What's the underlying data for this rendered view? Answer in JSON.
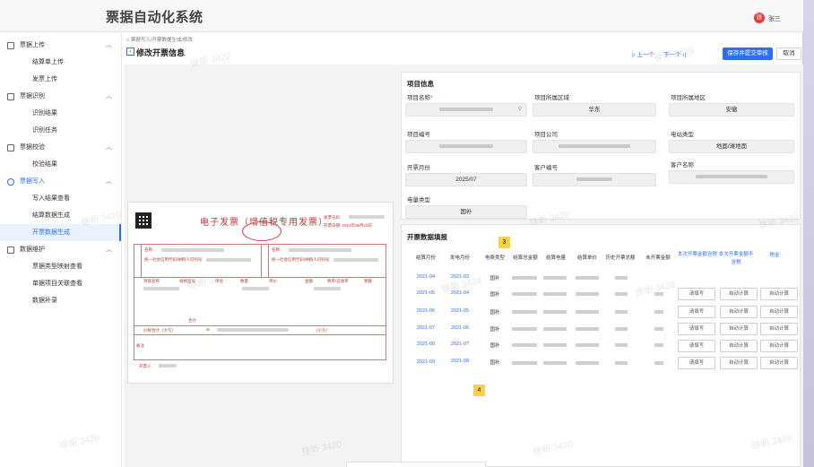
{
  "app": {
    "title": "票据自动化系统",
    "user": "张三",
    "avatar_initial": "张"
  },
  "sidebar": {
    "groups": [
      {
        "label": "票据上传",
        "items": [
          "结算单上传",
          "发票上传"
        ]
      },
      {
        "label": "票据识别",
        "items": [
          "识别结果",
          "识别任务"
        ]
      },
      {
        "label": "票据校验",
        "items": [
          "校验结果"
        ]
      },
      {
        "label": "票据写入",
        "items": [
          "写入结果查看",
          "结算数据生成",
          "开票数据生成"
        ],
        "active_item": "开票数据生成"
      },
      {
        "label": "数据维护",
        "items": [
          "票据类型映射查看",
          "单据项目关联查看",
          "数据补录"
        ]
      }
    ]
  },
  "breadcrumb": "票据写入/开票数据生成/修改",
  "header": {
    "page_title": "修改开票信息",
    "prev_label": "上一个",
    "next_label": "下一个",
    "save_label": "保存并提交审核",
    "cancel_label": "取消"
  },
  "invoice_image": {
    "title": "电子发票（增值税专用发票）",
    "stamp_text": "全国统一发票监制",
    "invoice_no_label": "发票号码:",
    "date_label": "开票日期: 2021年08月23日",
    "buyer_label": "购买方信息",
    "seller_label": "销售方信息",
    "name_label": "名称:",
    "taxid_label": "统一社会信用代码/纳税人识别号:",
    "item_label": "项目名称",
    "spec_label": "规格型号",
    "unit_label": "单位",
    "qty_label": "数量",
    "price_label": "单价",
    "amount_label": "金额",
    "rate_label": "税率/征收率",
    "tax_label": "税额",
    "total_label": "合计",
    "grand_label": "价税合计（大写）",
    "small_label": "（小写）",
    "remark_label": "备注",
    "issuer_label": "开票人:"
  },
  "project_info": {
    "section_title": "项目信息",
    "name_label": "项目名称",
    "region_label": "项目所属区域",
    "region_value": "华东",
    "area_label": "项目所属地区",
    "area_value": "安徽",
    "code_label": "项目编号",
    "company_label": "项目公司",
    "station_label": "电站类型",
    "station_value": "地面/滩地面",
    "month_label": "开票月份",
    "month_value": "2025/07",
    "customer_code_label": "客户编号",
    "customer_name_label": "客户名称",
    "power_type_label": "电量类型",
    "power_type_value": "国补"
  },
  "table": {
    "section_title": "开票数据填报",
    "headers": [
      "结算月份",
      "发电月份",
      "电费类型",
      "结算总金额",
      "结算电量",
      "结算单价",
      "历史开票总额",
      "未开票金额",
      "本次开票金额含税",
      "本次开票金额不含税",
      "税金"
    ],
    "rows": [
      {
        "settle": "2021-04",
        "gen": "2021-03",
        "type": "国补"
      },
      {
        "settle": "2021-05",
        "gen": "2021-04",
        "type": "国补"
      },
      {
        "settle": "2021-06",
        "gen": "2021-05",
        "type": "国补"
      },
      {
        "settle": "2021-07",
        "gen": "2021-06",
        "type": "国补"
      },
      {
        "settle": "2021-08",
        "gen": "2021-07",
        "type": "国补"
      },
      {
        "settle": "2021-09",
        "gen": "2021-08",
        "type": "国补"
      }
    ],
    "fill_placeholder": "请填写",
    "auto_calc_label": "自动计算"
  },
  "markers": [
    "3",
    "4"
  ],
  "watermark": "徐昕 3420",
  "colors": {
    "accent": "#2f6cf6",
    "invoice_red": "#b33a3a",
    "marker": "#f6d24a"
  }
}
